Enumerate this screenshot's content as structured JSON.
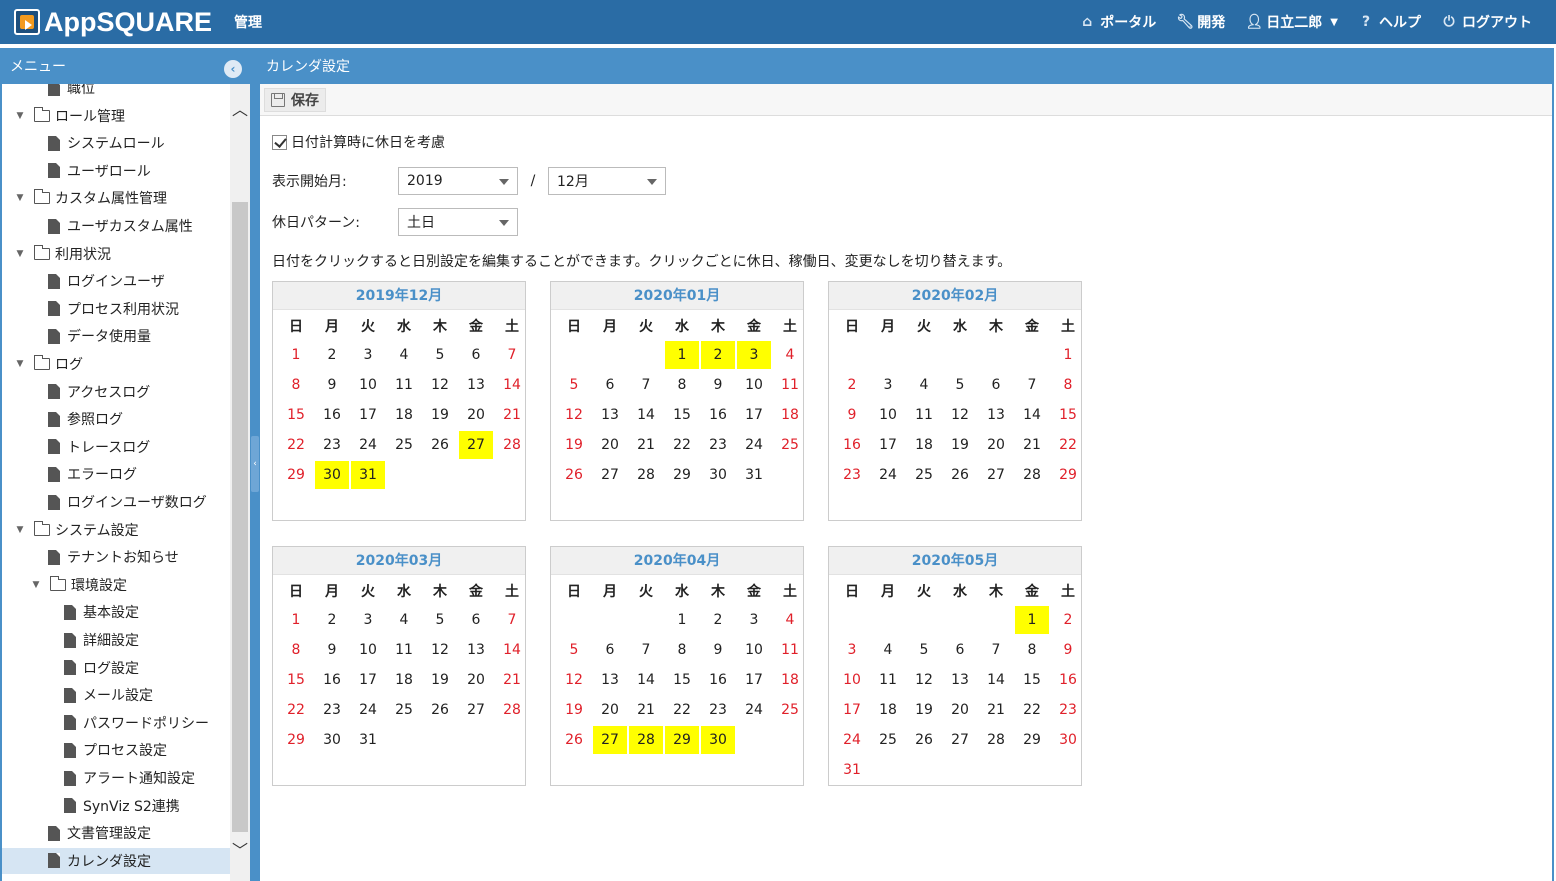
{
  "header": {
    "logo_text": "AppSQUARE",
    "admin_label": "管理",
    "nav": [
      {
        "icon": "home-icon",
        "label": "ポータル"
      },
      {
        "icon": "wrench-icon",
        "label": "開発"
      },
      {
        "icon": "user-icon",
        "label": "日立二郎"
      },
      {
        "icon": "help-icon",
        "label": "ヘルプ"
      },
      {
        "icon": "power-icon",
        "label": "ログアウト"
      }
    ]
  },
  "sidebar": {
    "title": "メニュー",
    "items": [
      {
        "label": "職位",
        "type": "doc",
        "level": 2
      },
      {
        "label": "ロール管理",
        "type": "folder",
        "level": 1
      },
      {
        "label": "システムロール",
        "type": "doc",
        "level": 2
      },
      {
        "label": "ユーザロール",
        "type": "doc",
        "level": 2
      },
      {
        "label": "カスタム属性管理",
        "type": "folder",
        "level": 1
      },
      {
        "label": "ユーザカスタム属性",
        "type": "doc",
        "level": 2
      },
      {
        "label": "利用状況",
        "type": "folder",
        "level": 1
      },
      {
        "label": "ログインユーザ",
        "type": "doc",
        "level": 2
      },
      {
        "label": "プロセス利用状況",
        "type": "doc",
        "level": 2
      },
      {
        "label": "データ使用量",
        "type": "doc",
        "level": 2
      },
      {
        "label": "ログ",
        "type": "folder",
        "level": 1
      },
      {
        "label": "アクセスログ",
        "type": "doc",
        "level": 2
      },
      {
        "label": "参照ログ",
        "type": "doc",
        "level": 2
      },
      {
        "label": "トレースログ",
        "type": "doc",
        "level": 2
      },
      {
        "label": "エラーログ",
        "type": "doc",
        "level": 2
      },
      {
        "label": "ログインユーザ数ログ",
        "type": "doc",
        "level": 2
      },
      {
        "label": "システム設定",
        "type": "folder",
        "level": 1
      },
      {
        "label": "テナントお知らせ",
        "type": "doc",
        "level": 2
      },
      {
        "label": "環境設定",
        "type": "folder",
        "level": 2
      },
      {
        "label": "基本設定",
        "type": "doc",
        "level": 3
      },
      {
        "label": "詳細設定",
        "type": "doc",
        "level": 3
      },
      {
        "label": "ログ設定",
        "type": "doc",
        "level": 3
      },
      {
        "label": "メール設定",
        "type": "doc",
        "level": 3
      },
      {
        "label": "パスワードポリシー",
        "type": "doc",
        "level": 3
      },
      {
        "label": "プロセス設定",
        "type": "doc",
        "level": 3
      },
      {
        "label": "アラート通知設定",
        "type": "doc",
        "level": 3
      },
      {
        "label": "SynViz S2連携",
        "type": "doc",
        "level": 3
      },
      {
        "label": "文書管理設定",
        "type": "doc",
        "level": 2
      },
      {
        "label": "カレンダ設定",
        "type": "doc",
        "level": 2,
        "selected": true
      }
    ]
  },
  "main": {
    "title": "カレンダ設定",
    "save_label": "保存",
    "consider_holidays_label": "日付計算時に休日を考慮",
    "consider_holidays_checked": true,
    "start_month_label": "表示開始月:",
    "start_year_value": "2019",
    "separator": "/",
    "start_month_value": "12月",
    "holiday_pattern_label": "休日パターン:",
    "holiday_pattern_value": "土日",
    "hint": "日付をクリックすると日別設定を編集することができます。クリックごとに休日、稼働日、変更なしを切り替えます。",
    "weekdays": [
      "日",
      "月",
      "火",
      "水",
      "木",
      "金",
      "土"
    ]
  },
  "calendars": [
    {
      "title": "2019年12月",
      "year": 2019,
      "month": 12,
      "highlighted": [
        27,
        30,
        31
      ]
    },
    {
      "title": "2020年01月",
      "year": 2020,
      "month": 1,
      "highlighted": [
        1,
        2,
        3
      ]
    },
    {
      "title": "2020年02月",
      "year": 2020,
      "month": 2,
      "highlighted": []
    },
    {
      "title": "2020年03月",
      "year": 2020,
      "month": 3,
      "highlighted": []
    },
    {
      "title": "2020年04月",
      "year": 2020,
      "month": 4,
      "highlighted": [
        27,
        28,
        29,
        30
      ]
    },
    {
      "title": "2020年05月",
      "year": 2020,
      "month": 5,
      "highlighted": [
        1
      ]
    }
  ],
  "colors": {
    "header_bg": "#2a6ca5",
    "panel_head_bg": "#4a90c8",
    "holiday_text": "#e0202a",
    "highlight": "#ffff00"
  }
}
